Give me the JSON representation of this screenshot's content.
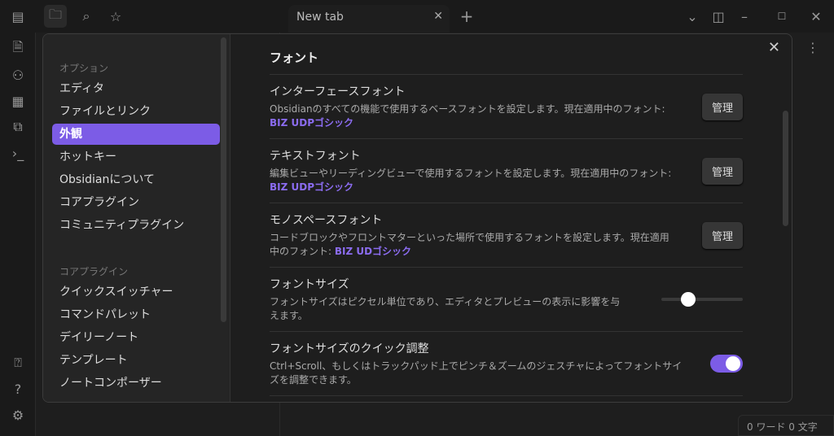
{
  "titlebar": {
    "icons": [
      "sidebar-toggle-icon",
      "folder-icon",
      "search-icon",
      "star-icon"
    ],
    "tab_label": "New tab",
    "new_tab": "+",
    "window_controls": [
      "chevron-down-icon",
      "layout-icon",
      "minimize-icon",
      "maximize-icon",
      "close-icon"
    ]
  },
  "ribbon": {
    "icons": [
      "quick-switcher-icon",
      "graph-icon",
      "calendar-icon",
      "copy-icon",
      "terminal-icon",
      "vault-icon",
      "help-icon",
      "settings-icon"
    ]
  },
  "status": {
    "text": "0 ワード  0 文字"
  },
  "settings": {
    "nav": {
      "section1": "オプション",
      "items1": [
        "エディタ",
        "ファイルとリンク",
        "外観",
        "ホットキー",
        "Obsidianについて",
        "コアプラグイン",
        "コミュニティプラグイン"
      ],
      "active": "外観",
      "section2": "コアプラグイン",
      "items2": [
        "クイックスイッチャー",
        "コマンドパレット",
        "デイリーノート",
        "テンプレート",
        "ノートコンポーザー"
      ]
    },
    "heading": "フォント",
    "rows": [
      {
        "name": "インターフェースフォント",
        "desc": "Obsidianのすべての機能で使用するベースフォントを設定します。現在適用中のフォント: ",
        "value": "BIZ UDPゴシック",
        "button": "管理"
      },
      {
        "name": "テキストフォント",
        "desc": "編集ビューやリーディングビューで使用するフォントを設定します。現在適用中のフォント: ",
        "value": "BIZ UDPゴシック",
        "button": "管理"
      },
      {
        "name": "モノスペースフォント",
        "desc": "コードブロックやフロントマターといった場所で使用するフォントを設定します。現在適用中のフォント: ",
        "value": "BIZ UDゴシック",
        "button": "管理"
      },
      {
        "name": "フォントサイズ",
        "desc": "フォントサイズはピクセル単位であり、エディタとプレビューの表示に影響を与えます。",
        "slider_fraction": 0.33
      },
      {
        "name": "フォントサイズのクイック調整",
        "desc": "Ctrl+Scroll、もしくはトラックパッド上でピンチ＆ズームのジェスチャによってフォントサイズを調整できます。",
        "toggle_on": true
      }
    ]
  },
  "colors": {
    "accent": "#7c5ce6"
  }
}
